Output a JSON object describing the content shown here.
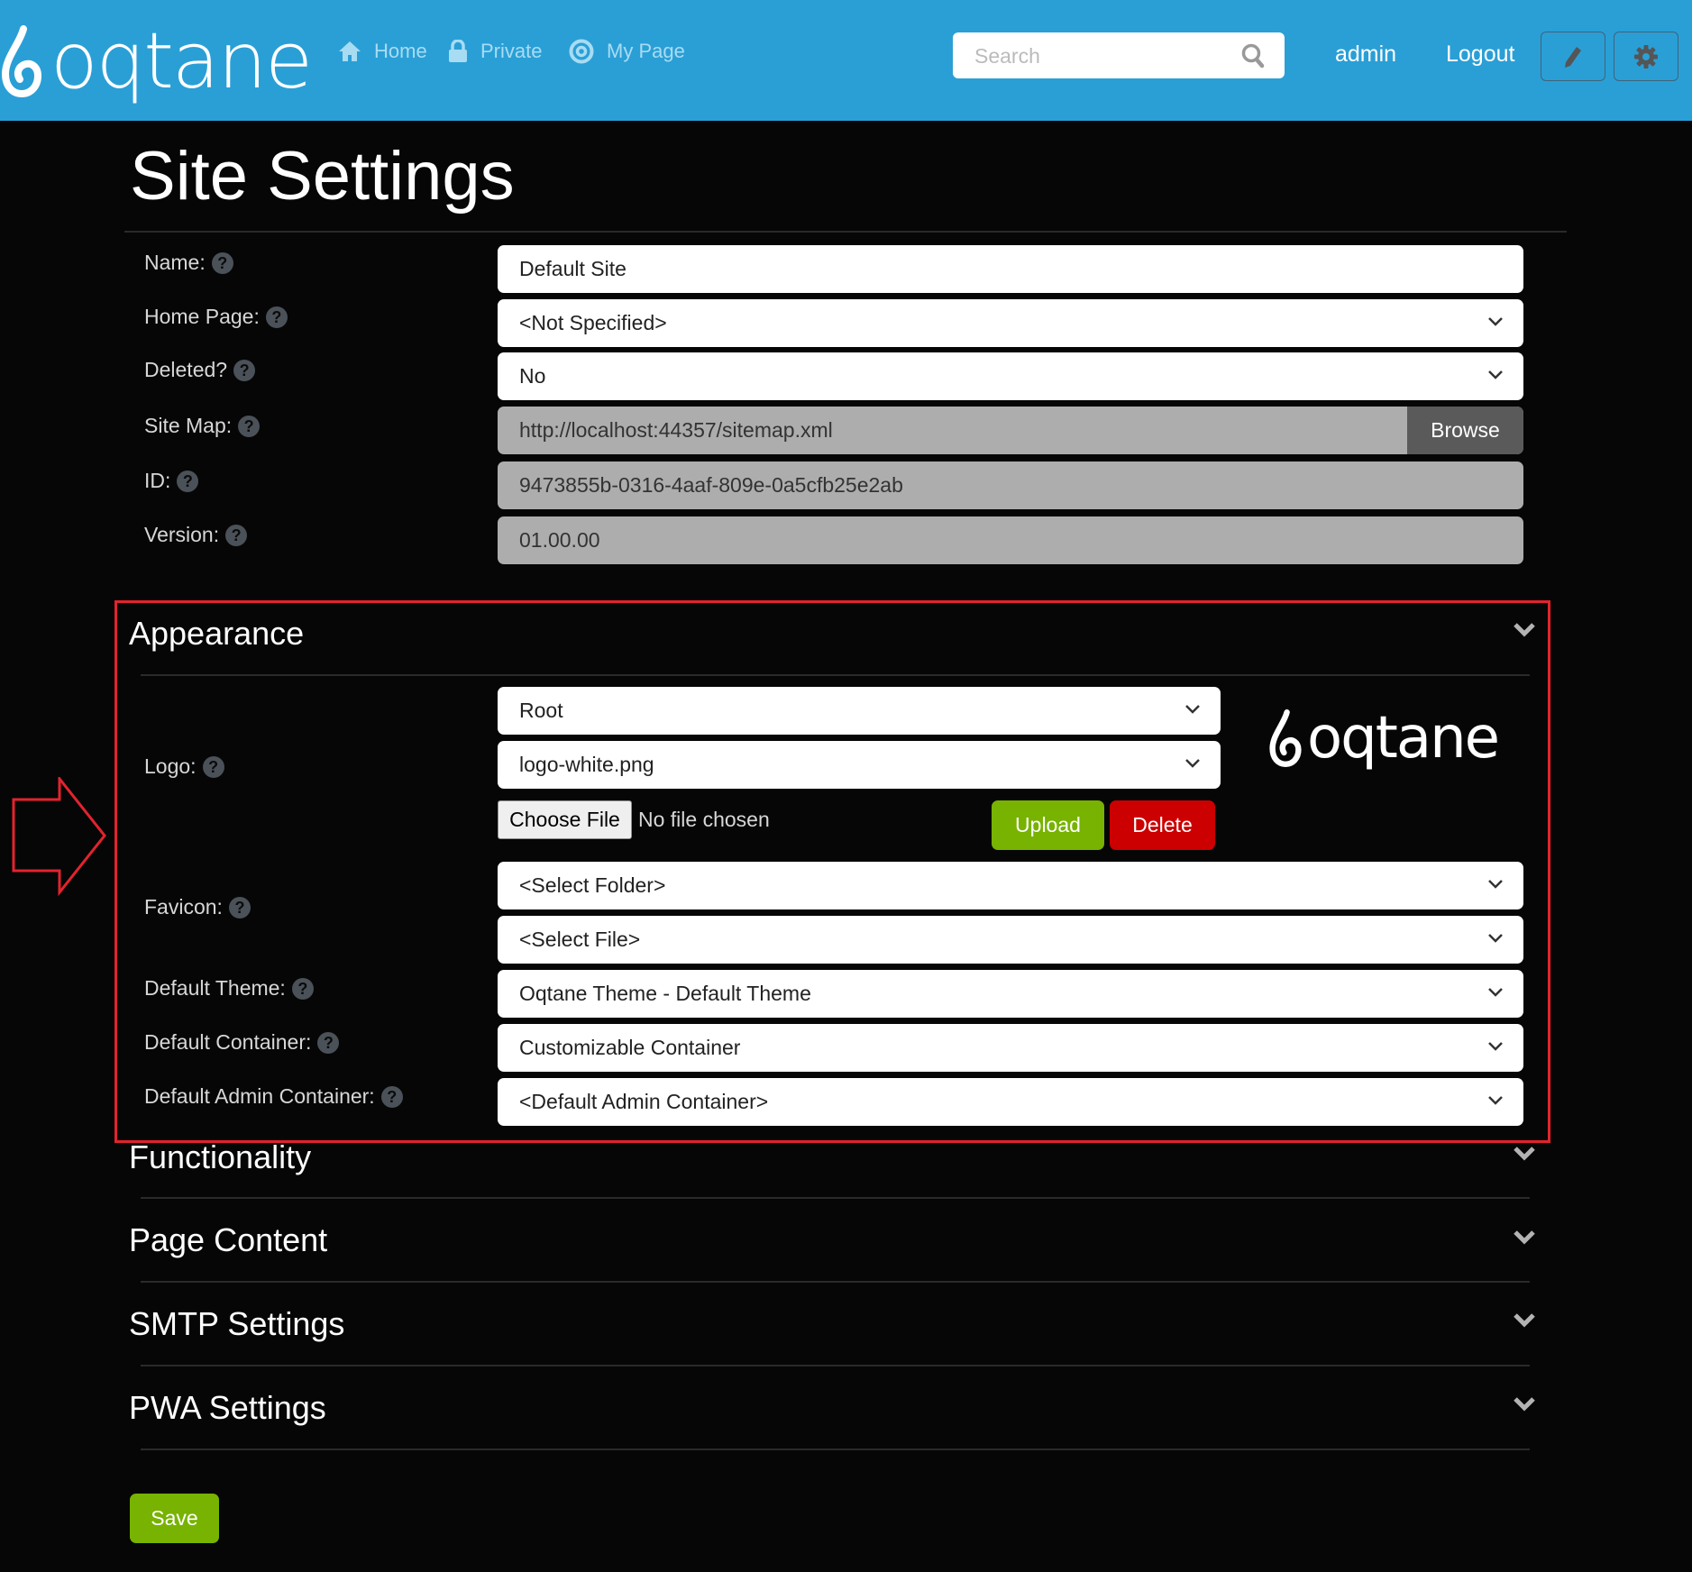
{
  "header": {
    "brand": "oqtane",
    "nav": [
      {
        "label": "Home",
        "icon": "home-icon"
      },
      {
        "label": "Private",
        "icon": "lock-icon"
      },
      {
        "label": "My Page",
        "icon": "target-icon"
      }
    ],
    "search_placeholder": "Search",
    "user": "admin",
    "logout": "Logout",
    "edit_icon": "pencil-icon",
    "settings_icon": "gear-icon",
    "accent": "#2a9fd6"
  },
  "page": {
    "title": "Site Settings"
  },
  "general": {
    "name": {
      "label": "Name:",
      "value": "Default Site"
    },
    "home_page": {
      "label": "Home Page:",
      "value": "<Not Specified>"
    },
    "deleted": {
      "label": "Deleted?",
      "value": "No"
    },
    "site_map": {
      "label": "Site Map:",
      "value": "http://localhost:44357/sitemap.xml",
      "button": "Browse"
    },
    "id": {
      "label": "ID:",
      "value": "9473855b-0316-4aaf-809e-0a5cfb25e2ab"
    },
    "version": {
      "label": "Version:",
      "value": "01.00.00"
    }
  },
  "appearance": {
    "title": "Appearance",
    "logo": {
      "label": "Logo:",
      "folder": "Root",
      "file": "logo-white.png",
      "choose_file": "Choose File",
      "no_file": "No file chosen",
      "upload": "Upload",
      "delete": "Delete",
      "preview_text": "oqtane"
    },
    "favicon": {
      "label": "Favicon:",
      "folder": "<Select Folder>",
      "file": "<Select File>"
    },
    "default_theme": {
      "label": "Default Theme:",
      "value": "Oqtane Theme - Default Theme"
    },
    "default_container": {
      "label": "Default Container:",
      "value": "Customizable Container"
    },
    "default_admin_container": {
      "label": "Default Admin Container:",
      "value": "<Default Admin Container>"
    }
  },
  "sections": [
    {
      "title": "Functionality"
    },
    {
      "title": "Page Content"
    },
    {
      "title": "SMTP Settings"
    },
    {
      "title": "PWA Settings"
    }
  ],
  "footer": {
    "save": "Save"
  },
  "annotation": {
    "highlight_color": "#e3232d"
  }
}
